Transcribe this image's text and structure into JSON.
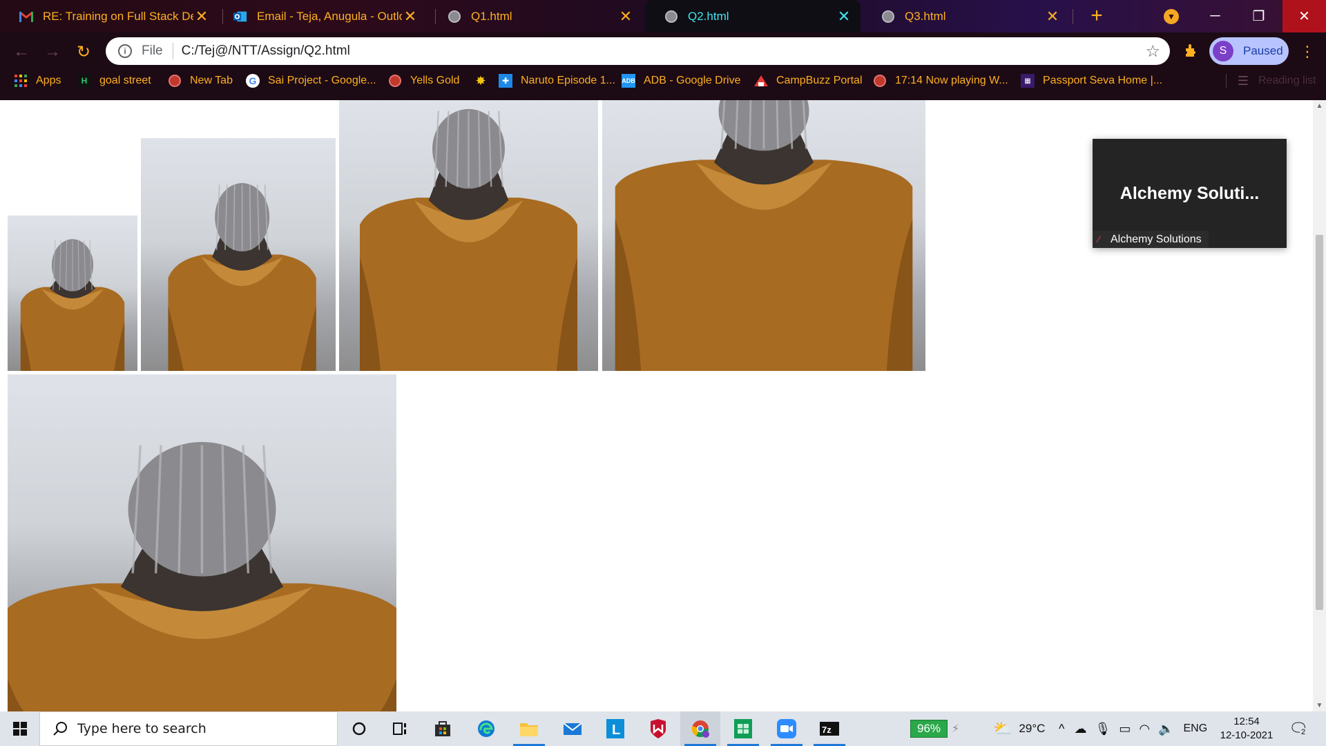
{
  "browser": {
    "tabs": [
      {
        "title": "RE: Training on Full Stack Develo",
        "icon": "gmail-icon",
        "active": false
      },
      {
        "title": "Email - Teja, Anugula - Outlook",
        "icon": "outlook-icon",
        "active": false
      },
      {
        "title": "Q1.html",
        "icon": "globe-icon",
        "active": false
      },
      {
        "title": "Q2.html",
        "icon": "globe-icon",
        "active": true
      },
      {
        "title": "Q3.html",
        "icon": "globe-icon",
        "active": false
      }
    ],
    "address_bar": {
      "scheme": "File",
      "url": "C:/Tej@/NTT/Assign/Q2.html"
    },
    "profile": {
      "initial": "S",
      "status": "Paused"
    },
    "bookmarks": [
      {
        "title": "Apps",
        "icon": "apps-grid-icon"
      },
      {
        "title": "goal street",
        "icon": "goal-street-icon"
      },
      {
        "title": "New Tab",
        "icon": "globe-icon"
      },
      {
        "title": "Sai Project - Google...",
        "icon": "google-icon"
      },
      {
        "title": "Yells Gold",
        "icon": "globe-icon"
      },
      {
        "title": "",
        "icon": "sparkle-icon"
      },
      {
        "title": "Naruto Episode 1...",
        "icon": "naruto-icon"
      },
      {
        "title": "ADB - Google Drive",
        "icon": "drive-icon"
      },
      {
        "title": "CampBuzz Portal",
        "icon": "campbuzz-icon"
      },
      {
        "title": "17:14 Now playing W...",
        "icon": "globe-icon"
      },
      {
        "title": "Passport Seva Home |...",
        "icon": "passport-icon"
      }
    ],
    "reading_list": "Reading list",
    "colors": {
      "tab_text": "#ffb020",
      "active_tab_text": "#41e4f0"
    }
  },
  "page": {
    "images": [
      {
        "name": "person-image-1",
        "alt": "person in beanie and corduroy jacket"
      },
      {
        "name": "person-image-2",
        "alt": "person in beanie and corduroy jacket"
      },
      {
        "name": "person-image-3",
        "alt": "person in beanie and corduroy jacket"
      },
      {
        "name": "person-image-4",
        "alt": "person in beanie and corduroy jacket"
      },
      {
        "name": "person-image-5",
        "alt": "person in beanie and corduroy jacket"
      }
    ]
  },
  "zoom_tile": {
    "display_name": "Alchemy Soluti...",
    "participant_name": "Alchemy Solutions"
  },
  "taskbar": {
    "search_placeholder": "Type here to search",
    "apps": [
      "cortana-icon",
      "task-view-icon",
      "store-icon",
      "edge-icon",
      "file-explorer-icon",
      "mail-icon",
      "l-app-icon",
      "mcafee-icon",
      "chrome-icon",
      "sheets-icon",
      "zoom-icon",
      "7zip-icon"
    ],
    "battery": "96%",
    "weather": "29°C",
    "language": "ENG",
    "time": "12:54",
    "date": "12-10-2021",
    "notifications": "2"
  }
}
